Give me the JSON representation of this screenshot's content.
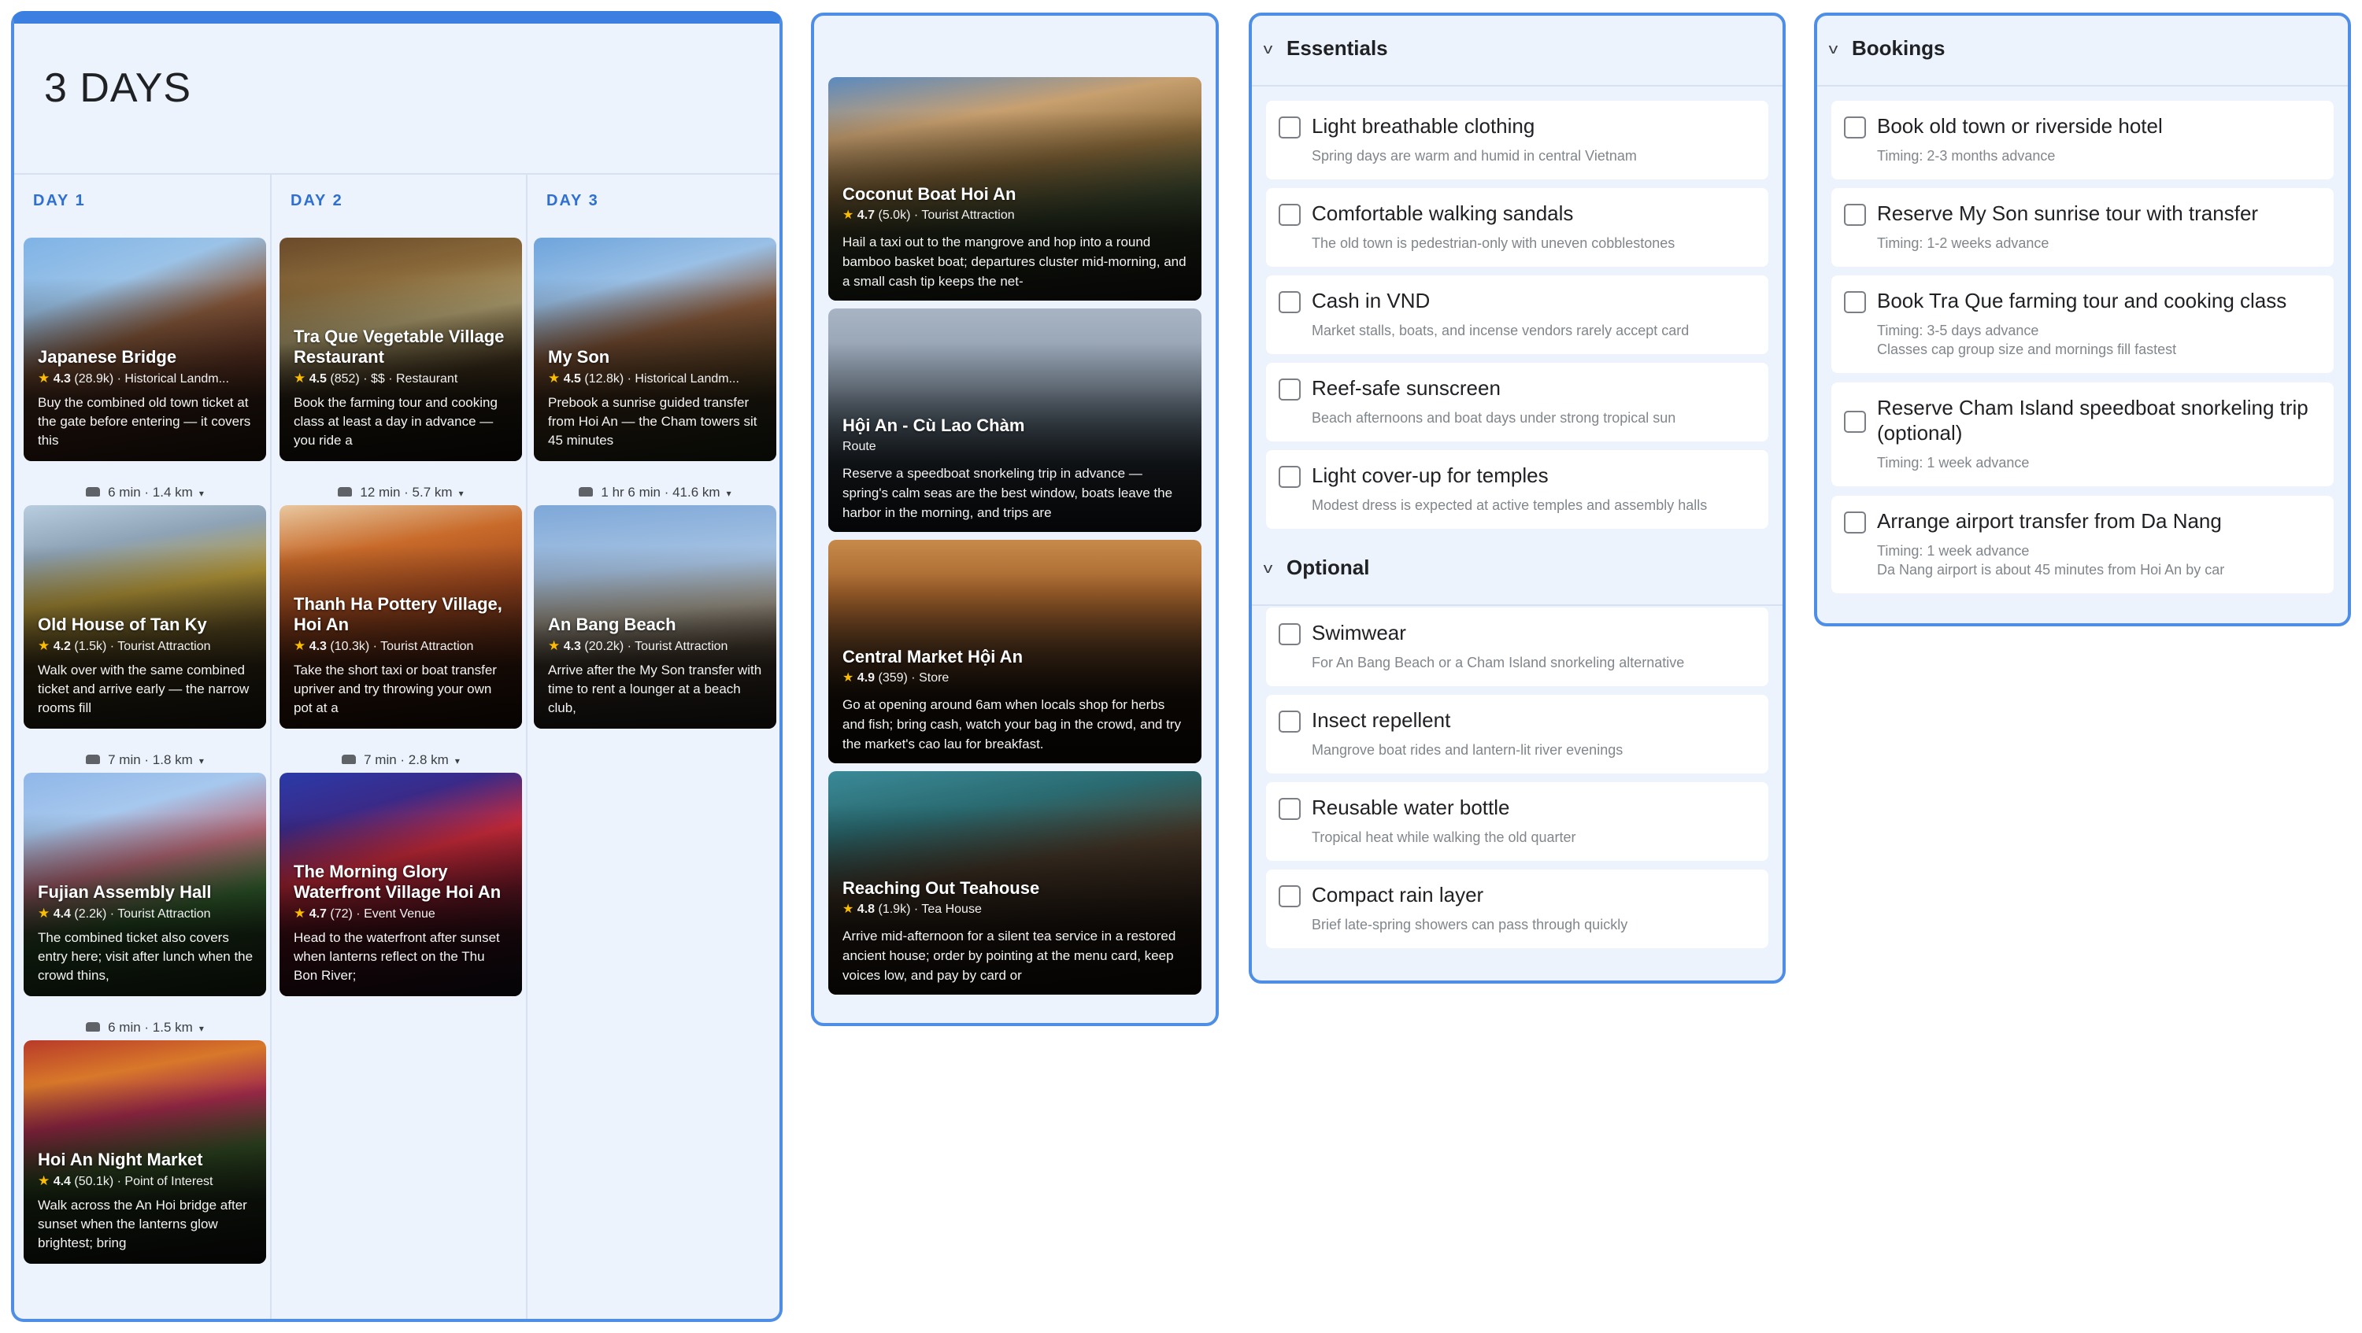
{
  "itinerary": {
    "title": "3 DAYS",
    "days": [
      {
        "label": "DAY 1",
        "stops": [
          {
            "name_lines": [
              "Japanese Bridge"
            ],
            "rating": "4.3",
            "reviews": "(28.9k)",
            "category": "Historical Landm...",
            "desc": "Buy the combined old town ticket at the gate before entering — it covers this"
          },
          {
            "name_lines": [
              "Old House of Tan Ky"
            ],
            "rating": "4.2",
            "reviews": "(1.5k)",
            "category": "Tourist Attraction",
            "desc": "Walk over with the same combined ticket and arrive early — the narrow rooms fill"
          },
          {
            "name_lines": [
              "Fujian Assembly Hall"
            ],
            "rating": "4.4",
            "reviews": "(2.2k)",
            "category": "Tourist Attraction",
            "desc": "The combined ticket also covers entry here; visit after lunch when the crowd thins,"
          },
          {
            "name_lines": [
              "Hoi An Night Market"
            ],
            "rating": "4.4",
            "reviews": "(50.1k)",
            "category": "Point of Interest",
            "desc": "Walk across the An Hoi bridge after sunset when the lanterns glow brightest; bring"
          }
        ],
        "transits": [
          "6 min · 1.4 km",
          "7 min · 1.8 km",
          "6 min · 1.5 km"
        ]
      },
      {
        "label": "DAY 2",
        "stops": [
          {
            "name_lines": [
              "Tra Que Vegetable Village",
              "Restaurant"
            ],
            "rating": "4.5",
            "reviews": "(852)",
            "category": "$$ · Restaurant",
            "desc": "Book the farming tour and cooking class at least a day in advance — you ride a"
          },
          {
            "name_lines": [
              "Thanh Ha Pottery Village,",
              "Hoi An"
            ],
            "rating": "4.3",
            "reviews": "(10.3k)",
            "category": "Tourist Attraction",
            "desc": "Take the short taxi or boat transfer upriver and try throwing your own pot at a"
          },
          {
            "name_lines": [
              "The Morning Glory",
              "Waterfront Village Hoi An"
            ],
            "rating": "4.7",
            "reviews": "(72)",
            "category": "Event Venue",
            "desc": "Head to the waterfront after sunset when lanterns reflect on the Thu Bon River;"
          }
        ],
        "transits": [
          "12 min · 5.7 km",
          "7 min · 2.8 km"
        ]
      },
      {
        "label": "DAY 3",
        "stops": [
          {
            "name_lines": [
              "My Son"
            ],
            "rating": "4.5",
            "reviews": "(12.8k)",
            "category": "Historical Landm...",
            "desc": "Prebook a sunrise guided transfer from Hoi An — the Cham towers sit 45 minutes"
          },
          {
            "name_lines": [
              "An Bang Beach"
            ],
            "rating": "4.3",
            "reviews": "(20.2k)",
            "category": "Tourist Attraction",
            "desc": "Arrive after the My Son transfer with time to rent a lounger at a beach club,"
          }
        ],
        "transits": [
          "1 hr 6 min · 41.6 km"
        ]
      }
    ]
  },
  "extras": [
    {
      "name": "Coconut Boat Hoi An",
      "rating": "4.7",
      "reviews": "(5.0k)",
      "category": "Tourist Attraction",
      "desc": "Hail a taxi out to the mangrove and hop into a round bamboo basket boat; departures cluster mid-morning, and a small cash tip keeps the net-"
    },
    {
      "name": "Hội An - Cù Lao Chàm",
      "rating": "",
      "reviews": "",
      "category": "Route",
      "desc": "Reserve a speedboat snorkeling trip in advance — spring's calm seas are the best window, boats leave the harbor in the morning, and trips are"
    },
    {
      "name": "Central Market Hội An",
      "rating": "4.9",
      "reviews": "(359)",
      "category": "Store",
      "desc": "Go at opening around 6am when locals shop for herbs and fish; bring cash, watch your bag in the crowd, and try the market's cao lau for breakfast."
    },
    {
      "name": "Reaching Out Teahouse",
      "rating": "4.8",
      "reviews": "(1.9k)",
      "category": "Tea House",
      "desc": "Arrive mid-afternoon for a silent tea service in a restored ancient house; order by pointing at the menu card, keep voices low, and pay by card or"
    }
  ],
  "packing": {
    "essentials_title": "Essentials",
    "essentials": [
      {
        "title": "Light breathable clothing",
        "sub": "Spring days are warm and humid in central Vietnam"
      },
      {
        "title": "Comfortable walking sandals",
        "sub": "The old town is pedestrian-only with uneven cobblestones"
      },
      {
        "title": "Cash in VND",
        "sub": "Market stalls, boats, and incense vendors rarely accept card"
      },
      {
        "title": "Reef-safe sunscreen",
        "sub": "Beach afternoons and boat days under strong tropical sun"
      },
      {
        "title": "Light cover-up for temples",
        "sub": "Modest dress is expected at active temples and assembly halls"
      }
    ],
    "optional_title": "Optional",
    "optional": [
      {
        "title": "Swimwear",
        "sub": "For An Bang Beach or a Cham Island snorkeling alternative"
      },
      {
        "title": "Insect repellent",
        "sub": "Mangrove boat rides and lantern-lit river evenings"
      },
      {
        "title": "Reusable water bottle",
        "sub": "Tropical heat while walking the old quarter"
      },
      {
        "title": "Compact rain layer",
        "sub": "Brief late-spring showers can pass through quickly"
      }
    ]
  },
  "bookings": {
    "title": "Bookings",
    "items": [
      {
        "title": "Book old town or riverside hotel",
        "timing": "Timing: 2-3 months advance",
        "note": ""
      },
      {
        "title": "Reserve My Son sunrise tour with transfer",
        "timing": "Timing: 1-2 weeks advance",
        "note": ""
      },
      {
        "title": "Book Tra Que farming tour and cooking class",
        "timing": "Timing: 3-5 days advance",
        "note": "Classes cap group size and mornings fill fastest"
      },
      {
        "title": "Reserve Cham Island speedboat snorkeling trip (optional)",
        "timing": "Timing: 1 week advance",
        "note": ""
      },
      {
        "title": "Arrange airport transfer from Da Nang",
        "timing": "Timing: 1 week advance",
        "note": "Da Nang airport is about 45 minutes from Hoi An by car"
      }
    ]
  },
  "icons": {
    "star": "star-icon",
    "car": "car-icon",
    "caret": "caret-down-icon",
    "chevron": "chevron-down-icon",
    "checkbox": "checkbox-icon"
  },
  "colors": {
    "accent": "#3b7fe0",
    "panel_bg": "#edf3fc",
    "day_label": "#2e6fd2",
    "star": "#fbbc04"
  }
}
